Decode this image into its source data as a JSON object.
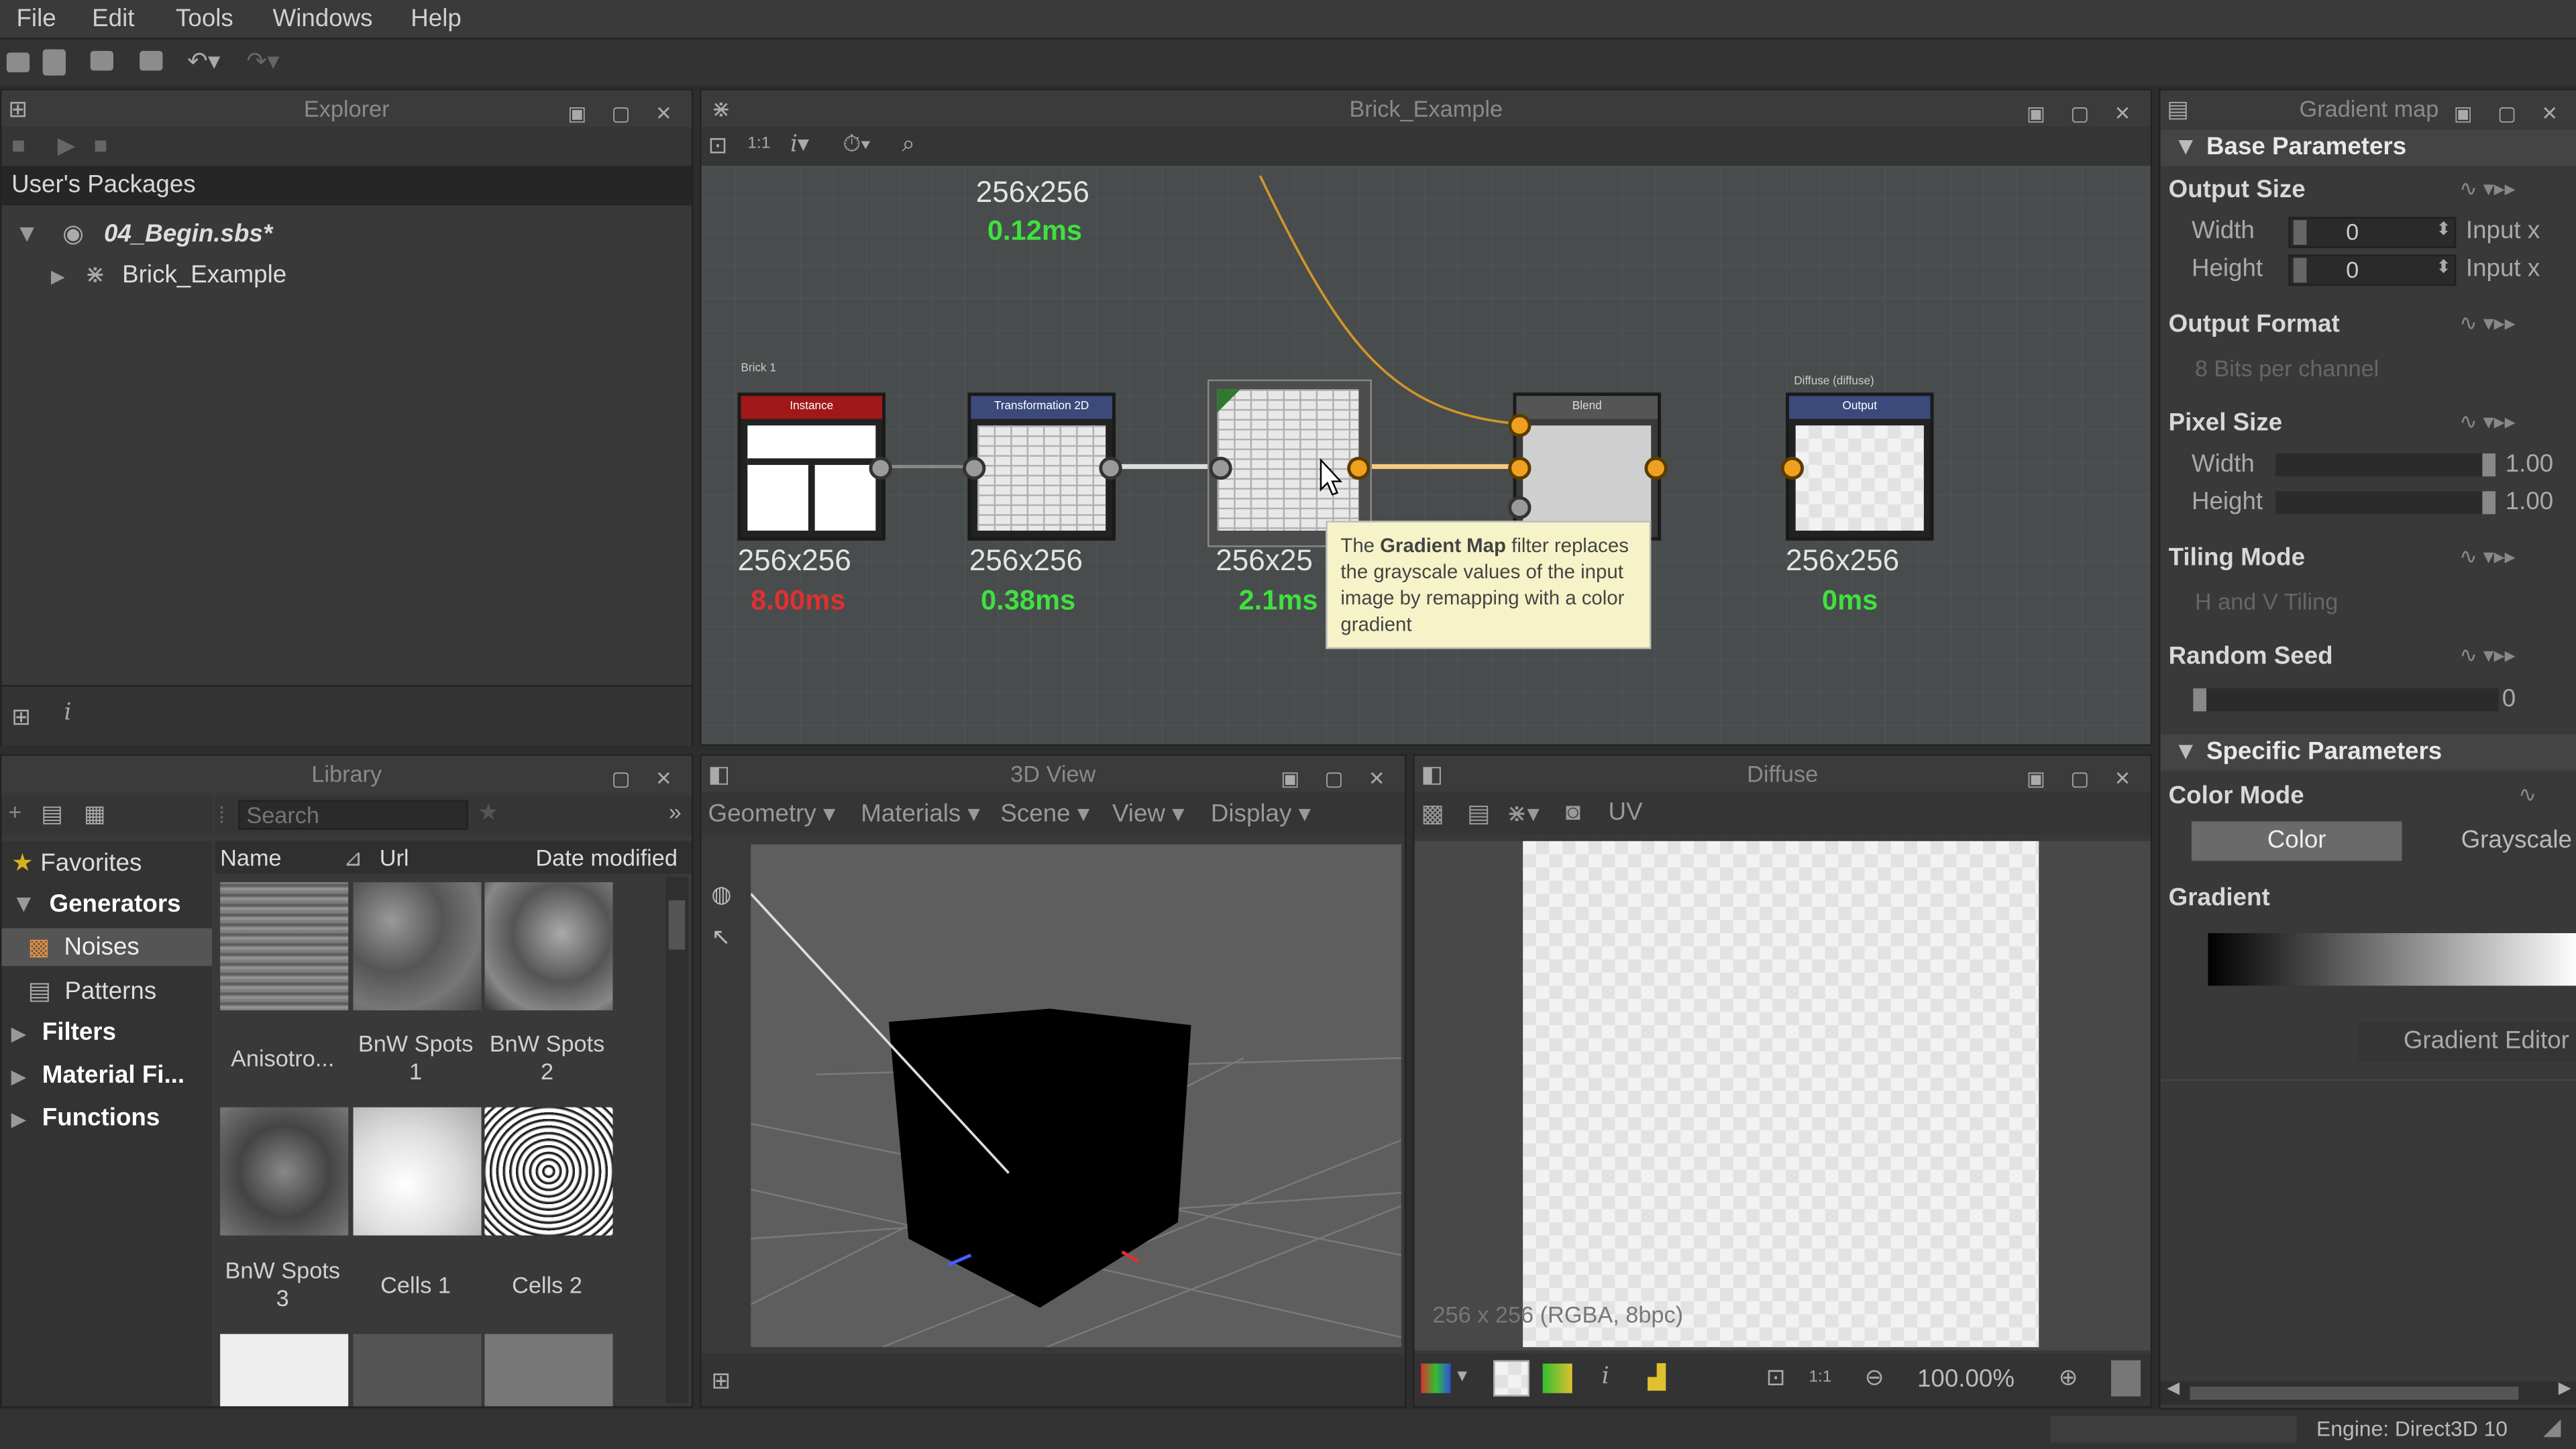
{
  "menu": [
    "File",
    "Edit",
    "Tools",
    "Windows",
    "Help"
  ],
  "explorer": {
    "title": "Explorer",
    "section": "User's Packages",
    "package": "04_Begin.sbs*",
    "graph": "Brick_Example"
  },
  "graph": {
    "title": "Brick_Example",
    "top_node": {
      "size": "256x256",
      "time": "0.12ms"
    },
    "nodes": [
      {
        "header": "Instance",
        "label": "Brick 1",
        "size": "256x256",
        "time": "8.00ms",
        "time_color": "#e03030"
      },
      {
        "header": "Transformation 2D",
        "label": "",
        "size": "256x256",
        "time": "0.38ms",
        "time_color": "#40e040"
      },
      {
        "header": "",
        "label": "",
        "size": "256x25",
        "time": "2.1ms",
        "time_color": "#40e040"
      },
      {
        "header": "Blend",
        "label": "",
        "size": "",
        "time": "",
        "time_color": "#40e040"
      },
      {
        "header": "Output",
        "label": "Diffuse (diffuse)",
        "size": "256x256",
        "time": "0ms",
        "time_color": "#40e040"
      }
    ],
    "tooltip": {
      "pre": "The ",
      "bold": "Gradient Map",
      "post": " filter replaces the grayscale values of the input image by remapping with a color gradient"
    }
  },
  "library": {
    "title": "Library",
    "search_placeholder": "Search",
    "categories": [
      "Favorites",
      "Generators",
      "Noises",
      "Patterns",
      "Filters",
      "Material Fi...",
      "Functions"
    ],
    "columns": [
      "Name",
      "Url",
      "Date modified"
    ],
    "items": [
      {
        "name": "Anisotro..."
      },
      {
        "name": "BnW Spots 1"
      },
      {
        "name": "BnW Spots 2"
      },
      {
        "name": "BnW Spots 3"
      },
      {
        "name": "Cells 1"
      },
      {
        "name": "Cells 2"
      }
    ]
  },
  "view3d": {
    "title": "3D View",
    "menus": [
      "Geometry",
      "Materials",
      "Scene",
      "View",
      "Display"
    ]
  },
  "view2d": {
    "title": "Diffuse",
    "uv_label": "UV",
    "status": "256 x 256 (RGBA, 8bpc)",
    "zoom": "100.00%"
  },
  "properties": {
    "title": "Gradient map",
    "base_section": "Base Parameters",
    "output_size": "Output Size",
    "width_label": "Width",
    "height_label": "Height",
    "width_value": "0",
    "height_value": "0",
    "input_x": "Input x",
    "output_format": "Output Format",
    "output_format_value": "8 Bits per channel",
    "pixel_size": "Pixel Size",
    "pixel_width": "1.00",
    "pixel_height": "1.00",
    "tiling_mode": "Tiling Mode",
    "tiling_value": "H and V Tiling",
    "random_seed": "Random Seed",
    "seed_value": "0",
    "specific_section": "Specific Parameters",
    "color_mode": "Color Mode",
    "color_btn": "Color",
    "grayscale_btn": "Grayscale",
    "gradient": "Gradient",
    "gradient_editor": "Gradient Editor"
  },
  "status": {
    "engine": "Engine: Direct3D 10"
  },
  "colors": {
    "accent_orange": "#f0a020",
    "timing_green": "#40e040",
    "timing_red": "#e03030"
  }
}
